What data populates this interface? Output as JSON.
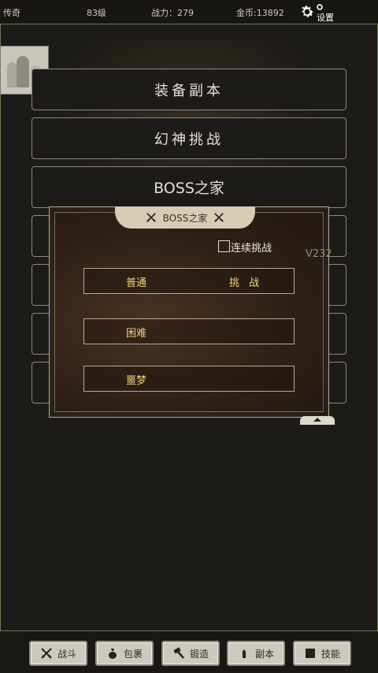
{
  "topbar": {
    "rank": "传奇",
    "level": "83级",
    "power": "战力：279",
    "gold": "金币:13892",
    "settings_label": "设置"
  },
  "menu": {
    "equip_dungeon": "装备副本",
    "illusion_challenge": "幻神挑战",
    "boss_home": "BOSS之家"
  },
  "dialog": {
    "title": "BOSS之家",
    "continuous_label": "连续挑战",
    "continuous_checked": false,
    "version": "V232",
    "rows": [
      {
        "label": "普通",
        "action": "挑 战"
      },
      {
        "label": "困难",
        "action": ""
      },
      {
        "label": "噩梦",
        "action": ""
      }
    ]
  },
  "bottom_nav": {
    "battle": "战斗",
    "bag": "包裹",
    "forge": "锻造",
    "dungeon": "副本",
    "skill": "技能"
  },
  "icons": {
    "settings": "gear-icon",
    "battle": "crossed-swords-icon",
    "bag": "bag-icon",
    "forge": "hammer-icon",
    "dungeon": "bullet-icon",
    "skill": "square-icon"
  },
  "colors": {
    "background": "#1d1b17",
    "accent_border": "#6f7a54",
    "gold_text": "#f0d37a",
    "tab_button": "#cdc9bd"
  }
}
